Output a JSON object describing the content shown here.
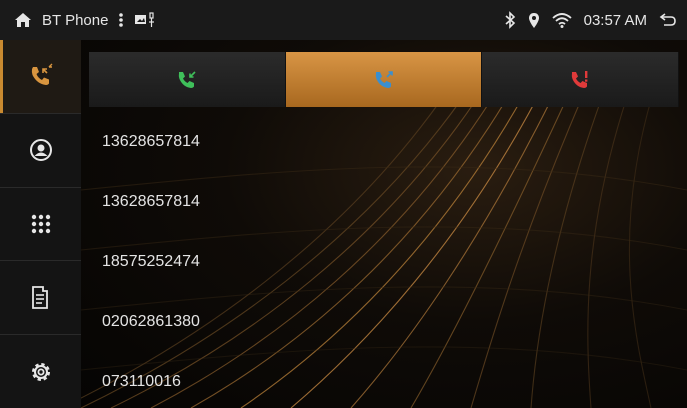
{
  "statusbar": {
    "app_title": "BT Phone",
    "time": "03:57 AM",
    "icons": [
      "home-icon",
      "more-vertical-icon",
      "usb-media-icon",
      "bluetooth-icon",
      "location-icon",
      "wifi-icon",
      "back-icon"
    ]
  },
  "sidebar": {
    "items": [
      {
        "name": "call-log",
        "icon": "call-log-icon",
        "active": true
      },
      {
        "name": "contacts",
        "icon": "contacts-icon",
        "active": false
      },
      {
        "name": "dialpad",
        "icon": "dialpad-icon",
        "active": false
      },
      {
        "name": "phonebook-sync",
        "icon": "document-icon",
        "active": false
      },
      {
        "name": "settings",
        "icon": "settings-icon",
        "active": false
      }
    ]
  },
  "tabs": [
    {
      "name": "received-calls",
      "icon": "incoming-call-icon",
      "color": "#3fbf5a",
      "active": false
    },
    {
      "name": "dialed-calls",
      "icon": "outgoing-call-icon",
      "color": "#3a8fd0",
      "active": true
    },
    {
      "name": "missed-calls",
      "icon": "missed-call-icon",
      "color": "#e03a3a",
      "active": false
    }
  ],
  "calls": [
    {
      "number": "13628657814"
    },
    {
      "number": "13628657814"
    },
    {
      "number": "18575252474"
    },
    {
      "number": "02062861380"
    },
    {
      "number": "073110016"
    }
  ],
  "colors": {
    "accent": "#c98a30",
    "tab_active": "#d89545",
    "background": "#0f0b07"
  }
}
